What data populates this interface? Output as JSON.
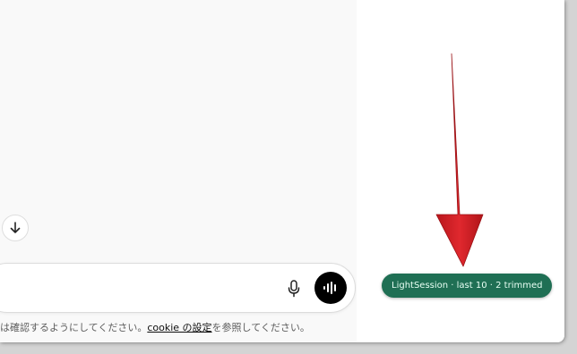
{
  "chat": {
    "disclaimer_prefix": "は確認するようにしてください。",
    "cookie_link": "cookie の設定",
    "disclaimer_suffix": "を参照してください。"
  },
  "icons": {
    "scroll_down": "arrow-down-icon",
    "mic": "microphone-icon",
    "voice": "voice-waveform-icon",
    "pointer": "red-down-arrow"
  },
  "extension_badge": {
    "label": "LightSession · last 10 · 2 trimmed",
    "background": "#1f6f54"
  },
  "colors": {
    "arrow": "#d32228",
    "voice_button": "#000000",
    "chat_background": "#f9f9f9"
  }
}
